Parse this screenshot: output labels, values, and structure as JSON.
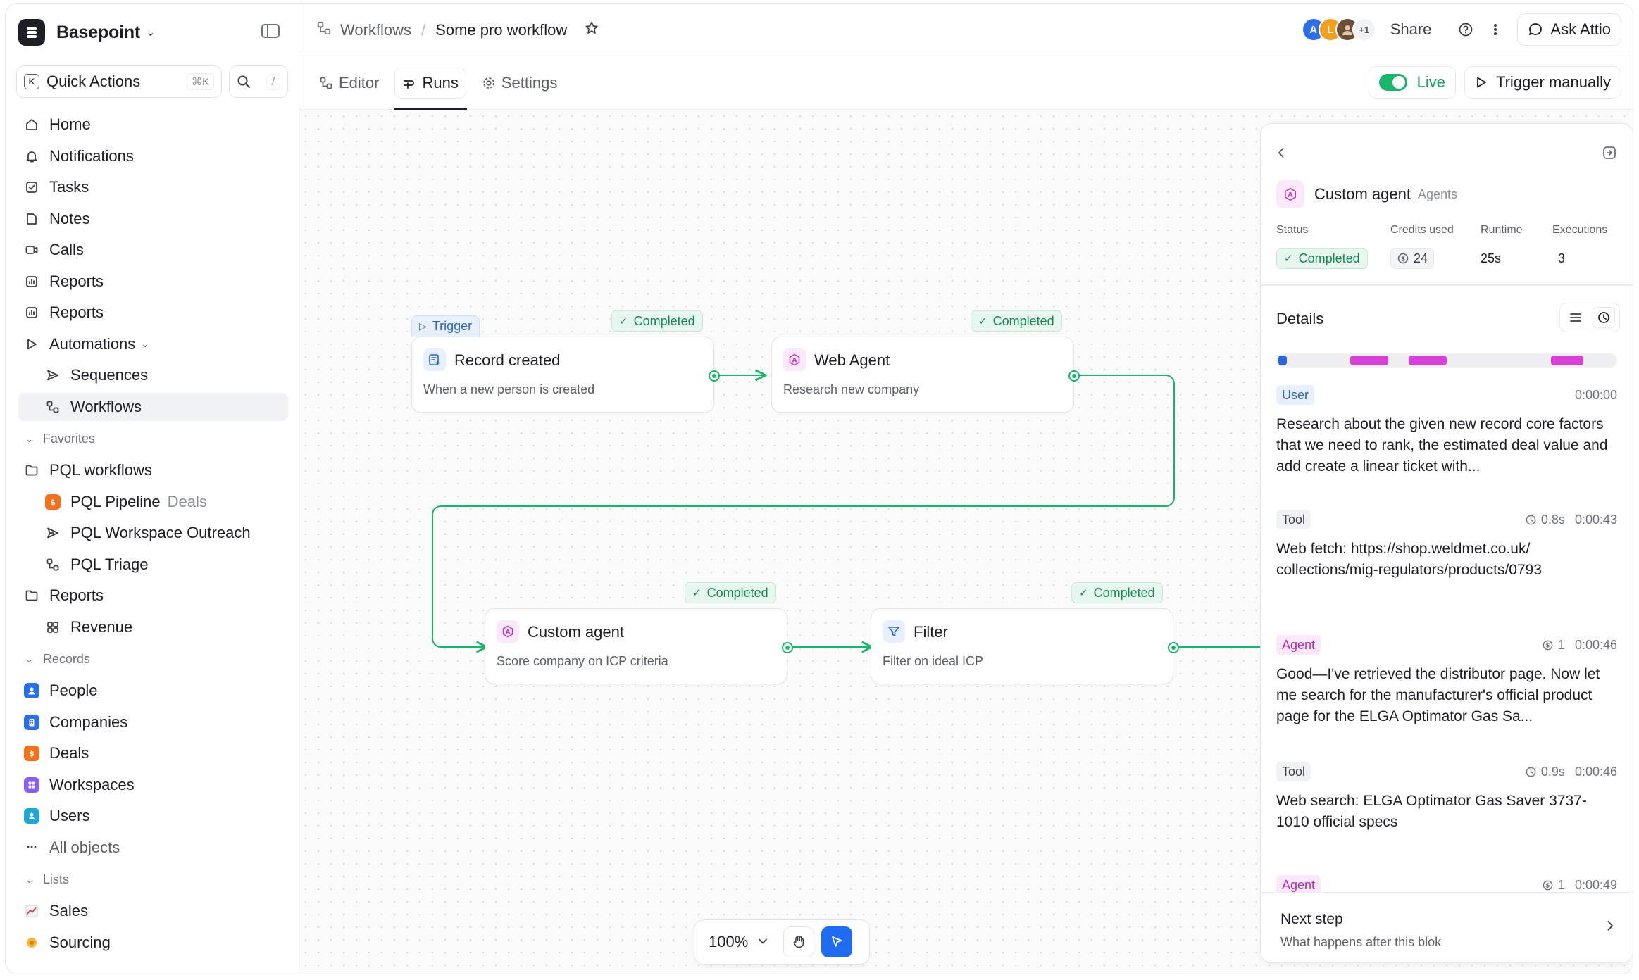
{
  "workspace": {
    "name": "Basepoint"
  },
  "quick_actions": {
    "label": "Quick Actions",
    "kbd": "⌘K",
    "search_kbd": "/"
  },
  "nav": {
    "home": "Home",
    "notifications": "Notifications",
    "tasks": "Tasks",
    "notes": "Notes",
    "calls": "Calls",
    "reports_1": "Reports",
    "reports_2": "Reports",
    "automations": "Automations",
    "sequences": "Sequences",
    "workflows": "Workflows"
  },
  "favorites": {
    "header": "Favorites",
    "pql_workflows": "PQL workflows",
    "pql_pipeline": "PQL Pipeline",
    "pql_pipeline_meta": "Deals",
    "pql_workspace_outreach": "PQL Workspace Outreach",
    "pql_triage": "PQL Triage",
    "reports": "Reports",
    "revenue": "Revenue"
  },
  "records": {
    "header": "Records",
    "people": "People",
    "companies": "Companies",
    "deals": "Deals",
    "workspaces": "Workspaces",
    "users": "Users",
    "all_objects": "All objects"
  },
  "lists": {
    "header": "Lists",
    "sales": "Sales",
    "sourcing": "Sourcing"
  },
  "breadcrumb": {
    "parent": "Workflows",
    "current": "Some pro workflow"
  },
  "header": {
    "avatars": [
      "A",
      "L",
      "",
      "+1"
    ],
    "share": "Share",
    "ask": "Ask Attio"
  },
  "tabs": {
    "editor": "Editor",
    "runs": "Runs",
    "settings": "Settings"
  },
  "live": {
    "label": "Live"
  },
  "trigger_manually": "Trigger manually",
  "nodes": {
    "record_created": {
      "tag": "Trigger",
      "status": "Completed",
      "title": "Record created",
      "subtitle": "When a new person is created"
    },
    "web_agent": {
      "status": "Completed",
      "title": "Web Agent",
      "subtitle": "Research new company"
    },
    "custom_agent": {
      "status": "Completed",
      "title": "Custom agent",
      "subtitle": "Score company on ICP criteria"
    },
    "filter": {
      "status": "Completed",
      "title": "Filter",
      "subtitle": "Filter on ideal ICP"
    }
  },
  "zoom": {
    "level": "100%"
  },
  "panel": {
    "title": "Custom agent",
    "meta": "Agents",
    "stats": {
      "status_label": "Status",
      "status_value": "Completed",
      "credits_label": "Credits used",
      "credits_value": "24",
      "runtime_label": "Runtime",
      "runtime_value": "25s",
      "executions_label": "Executions",
      "executions_value": "3"
    },
    "details_label": "Details",
    "events": [
      {
        "kind": "User",
        "time": "0:00:00",
        "text": "Research about the given new record core factors that we need to rank, the estimated deal value and add create a linear ticket with..."
      },
      {
        "kind": "Tool",
        "duration": "0.8s",
        "time": "0:00:43",
        "text": "Web fetch: https://shop.weldmet.co.uk/ collections/mig-regulators/products/0793"
      },
      {
        "kind": "Agent",
        "credits": "1",
        "time": "0:00:46",
        "text": "Good—I've retrieved the distributor page. Now let me search for the manufacturer's official product page for the ELGA Optimator Gas Sa..."
      },
      {
        "kind": "Tool",
        "duration": "0.9s",
        "time": "0:00:46",
        "text": "Web search: ELGA Optimator Gas Saver 3737-1010 official specs"
      },
      {
        "kind": "Agent",
        "credits": "1",
        "time": "0:00:49",
        "text": ""
      }
    ],
    "next_step": {
      "title": "Next step",
      "subtitle": "What happens after this blok"
    }
  },
  "colors": {
    "accent": "#1f6cf0",
    "success": "#19b56b",
    "agent": "#d93fd9",
    "user": "#2a63d6"
  }
}
